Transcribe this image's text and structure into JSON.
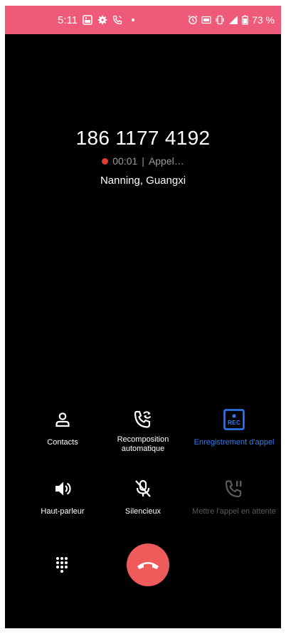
{
  "status_bar": {
    "time": "5:11",
    "battery": "73 %",
    "icons": [
      "notification-image-icon",
      "settings-gear-icon",
      "call-icon",
      "alarm-icon",
      "nfc-icon",
      "vibrate-icon",
      "signal-icon",
      "battery-icon"
    ]
  },
  "call": {
    "number": "186 1177 4192",
    "duration": "00:01",
    "separator": "|",
    "state": "Appel…",
    "location": "Nanning, Guangxi"
  },
  "actions": [
    {
      "label": "Contacts",
      "icon": "contacts-icon"
    },
    {
      "label": "Recomposition automatique",
      "icon": "auto-redial-icon"
    },
    {
      "label": "Enregistrement d'appel",
      "icon": "rec-icon"
    },
    {
      "label": "Haut-parleur",
      "icon": "speaker-icon"
    },
    {
      "label": "Silencieux",
      "icon": "mute-icon"
    },
    {
      "label": "Mettre l'appel en attente",
      "icon": "hold-icon"
    }
  ],
  "rec_badge": "REC",
  "colors": {
    "status_bar": "#ef5a78",
    "accent": "#2f7cf6",
    "end_call": "#ef5a5a",
    "rec_dot": "#e53935"
  }
}
